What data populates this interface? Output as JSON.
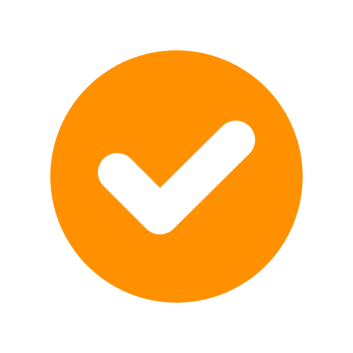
{
  "icon": {
    "name": "check-circle-icon",
    "circle_color": "#FF9100",
    "check_color": "#FFFFFF",
    "background_color": "#FFFFFF"
  }
}
